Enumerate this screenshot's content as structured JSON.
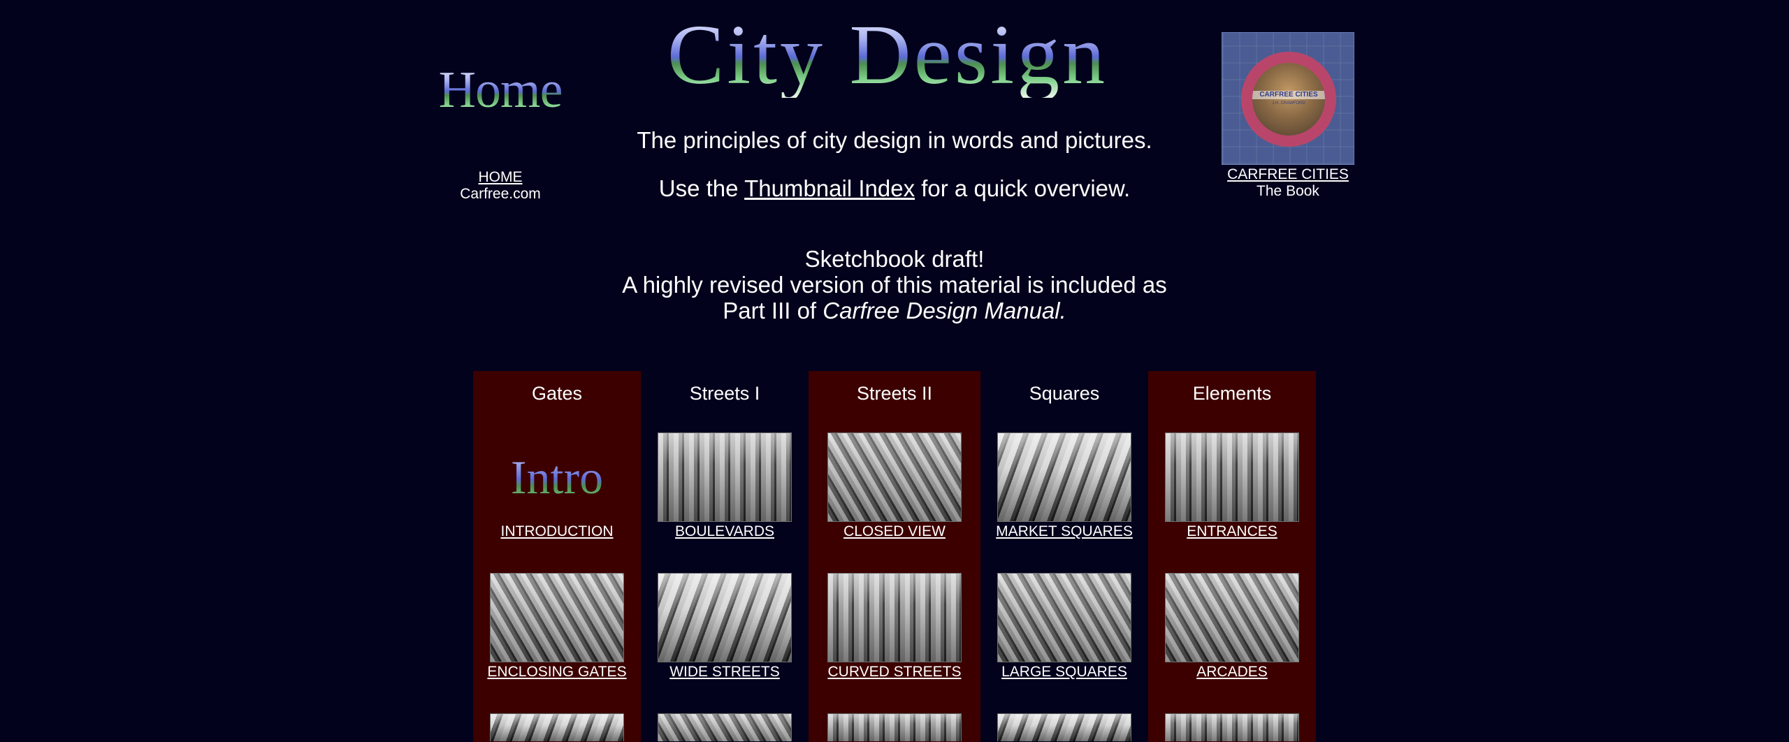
{
  "header": {
    "home_logo": "Home",
    "home_link": "HOME",
    "home_sub": "Carfree.com",
    "title_logo": "City Design",
    "tagline": "The principles of city design in words and pictures.",
    "index_prefix": "Use the ",
    "index_link": "Thumbnail Index",
    "index_suffix": " for a quick overview.",
    "book_cover_title": "CARFREE CITIES",
    "book_cover_author": "J.H. CRAWFORD",
    "book_link": "CARFREE CITIES",
    "book_sub": "The Book"
  },
  "notice": {
    "line1": "Sketchbook draft!",
    "line2": "A highly revised version of this material is included as",
    "line3_prefix": "Part III of ",
    "line3_title": "Carfree Design Manual."
  },
  "grid": {
    "intro_logo": "Intro",
    "columns": [
      {
        "header": "Gates",
        "items": [
          "INTRODUCTION",
          "ENCLOSING GATES"
        ]
      },
      {
        "header": "Streets I",
        "items": [
          "BOULEVARDS",
          "WIDE STREETS"
        ]
      },
      {
        "header": "Streets II",
        "items": [
          "CLOSED VIEW",
          "CURVED STREETS"
        ]
      },
      {
        "header": "Squares",
        "items": [
          "MARKET SQUARES",
          "LARGE SQUARES"
        ]
      },
      {
        "header": "Elements",
        "items": [
          "ENTRANCES",
          "ARCADES"
        ]
      }
    ]
  },
  "colors": {
    "page_background": "#03021c",
    "shaded_column": "#3c0000",
    "text": "#ffffff"
  }
}
